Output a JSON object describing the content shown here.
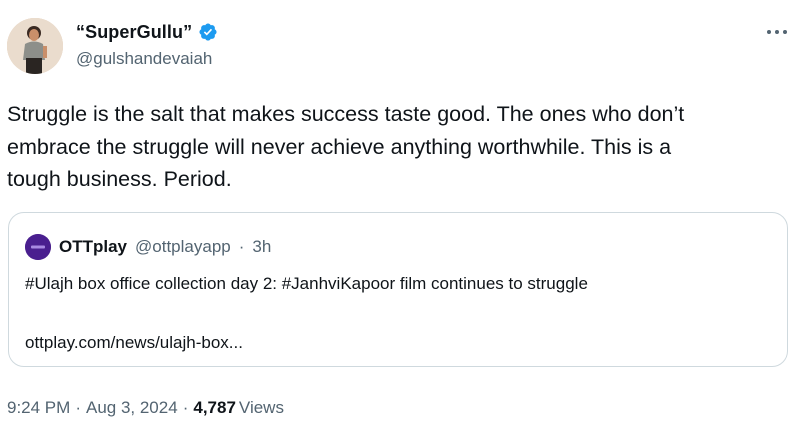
{
  "author": {
    "display_name": "“SuperGullu”",
    "handle": "@gulshandevaiah",
    "verified": true,
    "avatar_icon": "profile-photo"
  },
  "more_icon": "more-horizontal-icon",
  "tweet": {
    "lines": [
      "Struggle is the salt that makes success taste good. The ones who don’t",
      "embrace the struggle will never achieve anything worthwhile. This is a",
      "tough business. Period."
    ]
  },
  "quote": {
    "name": "OTTplay",
    "handle": "@ottplayapp",
    "separator": "·",
    "time": "3h",
    "text": "#Ulajh box office collection day 2: #JanhviKapoor film continues to struggle",
    "link": "ottplay.com/news/ulajh-box..."
  },
  "meta": {
    "time": "9:24 PM",
    "separator": "·",
    "date": "Aug 3, 2024",
    "views_count": "4,787",
    "views_label": "Views"
  },
  "colors": {
    "text": "#0f1419",
    "secondary": "#536471",
    "border": "#cfd9de",
    "verified": "#1d9bf0"
  }
}
